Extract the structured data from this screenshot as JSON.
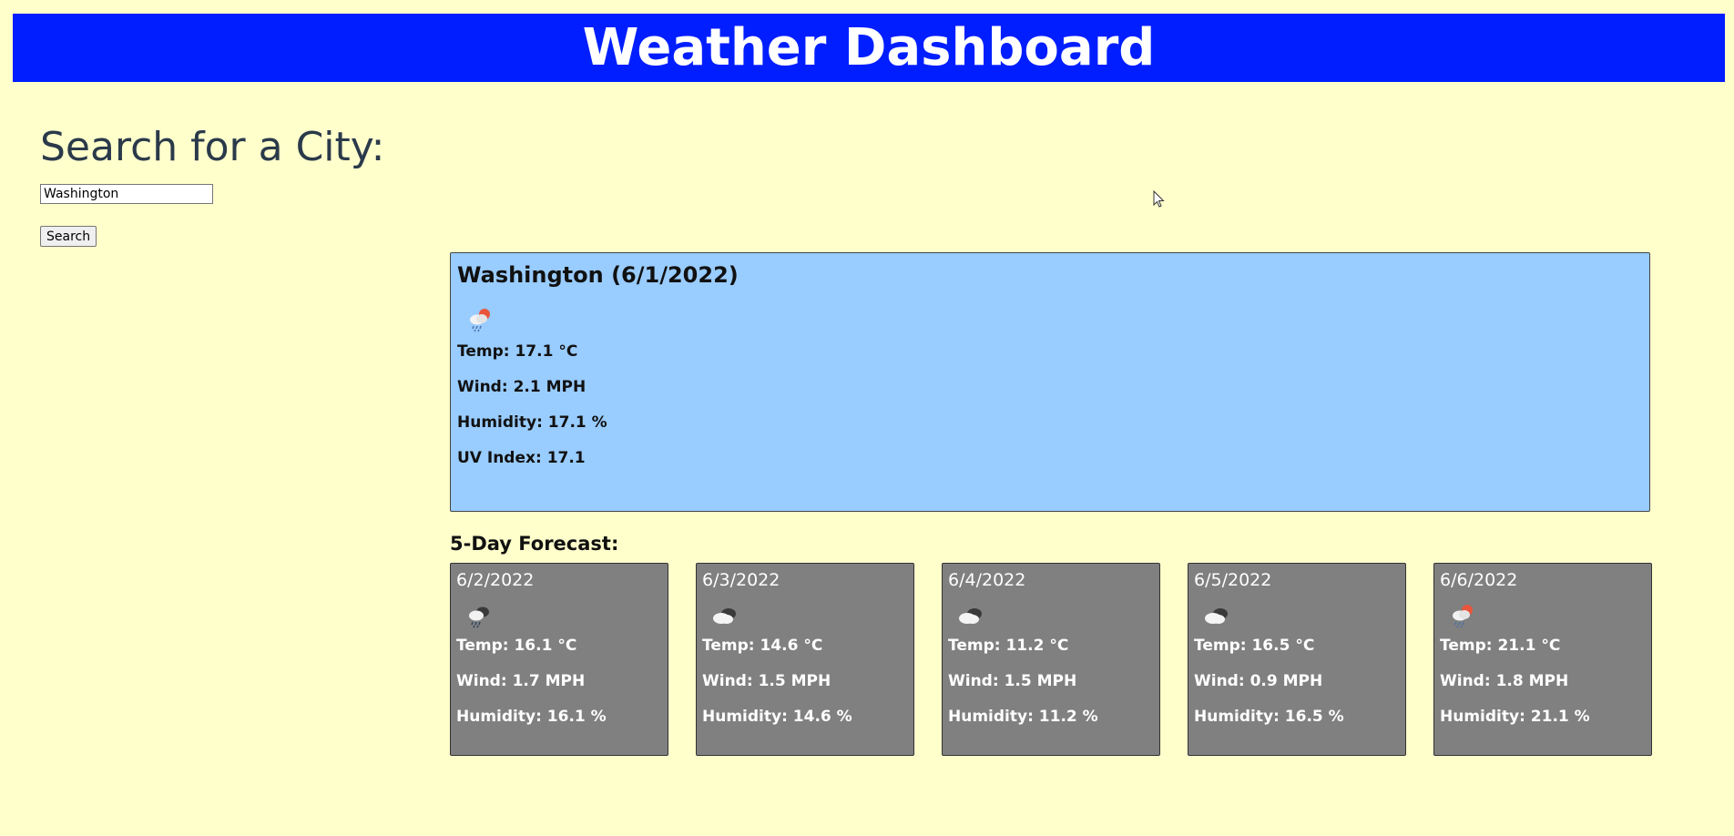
{
  "header": {
    "title": "Weather Dashboard"
  },
  "search": {
    "heading": "Search for a City:",
    "input_value": "Washington",
    "button_label": "Search"
  },
  "current": {
    "title": "Washington (6/1/2022)",
    "icon": "rain-cloud-sun-icon",
    "temp": "Temp: 17.1 °C",
    "wind": "Wind: 2.1 MPH",
    "humidity": "Humidity: 17.1 %",
    "uv": "UV Index: 17.1"
  },
  "forecast": {
    "title": "5-Day Forecast:",
    "days": [
      {
        "date": "6/2/2022",
        "icon": "rain-cloud-icon",
        "temp": "Temp: 16.1 °C",
        "wind": "Wind: 1.7 MPH",
        "humidity": "Humidity: 16.1 %"
      },
      {
        "date": "6/3/2022",
        "icon": "broken-clouds-icon",
        "temp": "Temp: 14.6 °C",
        "wind": "Wind: 1.5 MPH",
        "humidity": "Humidity: 14.6 %"
      },
      {
        "date": "6/4/2022",
        "icon": "broken-clouds-icon",
        "temp": "Temp: 11.2 °C",
        "wind": "Wind: 1.5 MPH",
        "humidity": "Humidity: 11.2 %"
      },
      {
        "date": "6/5/2022",
        "icon": "broken-clouds-icon",
        "temp": "Temp: 16.5 °C",
        "wind": "Wind: 0.9 MPH",
        "humidity": "Humidity: 16.5 %"
      },
      {
        "date": "6/6/2022",
        "icon": "rain-cloud-sun-icon",
        "temp": "Temp: 21.1 °C",
        "wind": "Wind: 1.8 MPH",
        "humidity": "Humidity: 21.1 %"
      }
    ]
  },
  "colors": {
    "page_bg": "#ffffcc",
    "header_bg": "#001eff",
    "current_bg": "#99ccff",
    "card_bg": "#808080"
  }
}
